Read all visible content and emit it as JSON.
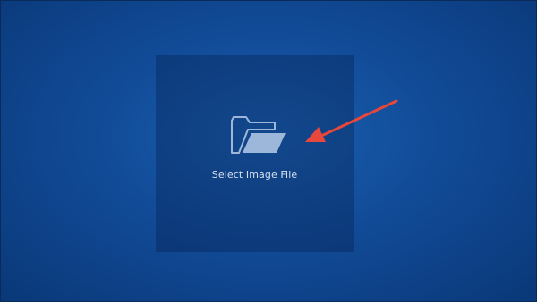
{
  "drop_zone": {
    "label": "Select Image File",
    "icon": "folder-open-icon"
  },
  "annotation": {
    "icon": "red-arrow-icon",
    "color": "#e8473b"
  },
  "colors": {
    "background": "#114b97",
    "drop_zone": "#0d3c7e",
    "icon": "#9db7db",
    "label": "#d6e2f2"
  }
}
